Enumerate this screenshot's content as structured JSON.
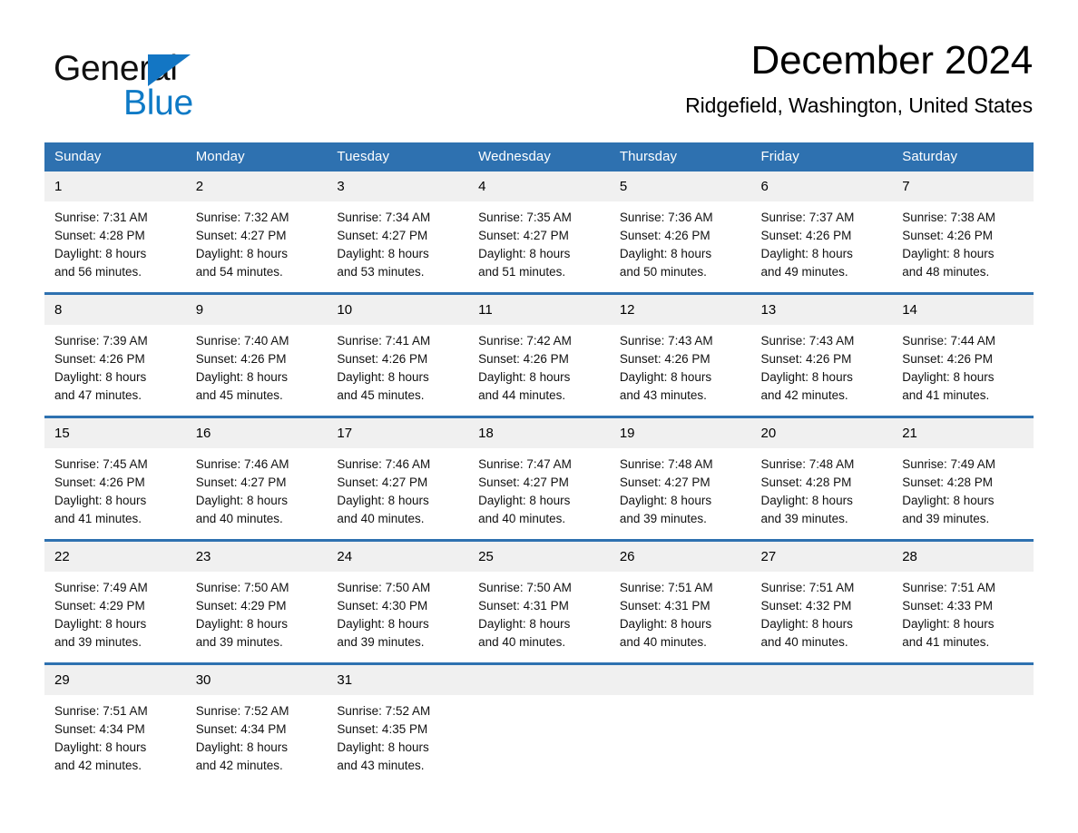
{
  "brand": {
    "word_general": "General",
    "word_blue": "Blue",
    "triangle_color": "#1376c4",
    "blue_text_color": "#0e7ac6"
  },
  "header": {
    "title": "December 2024",
    "subtitle": "Ridgefield, Washington, United States",
    "accent_color": "#2e71b0",
    "daynum_band_color": "#f0f0f0"
  },
  "weekday_headers": [
    "Sunday",
    "Monday",
    "Tuesday",
    "Wednesday",
    "Thursday",
    "Friday",
    "Saturday"
  ],
  "weeks": [
    [
      {
        "day": "1",
        "sunrise": "Sunrise: 7:31 AM",
        "sunset": "Sunset: 4:28 PM",
        "daylight1": "Daylight: 8 hours",
        "daylight2": "and 56 minutes."
      },
      {
        "day": "2",
        "sunrise": "Sunrise: 7:32 AM",
        "sunset": "Sunset: 4:27 PM",
        "daylight1": "Daylight: 8 hours",
        "daylight2": "and 54 minutes."
      },
      {
        "day": "3",
        "sunrise": "Sunrise: 7:34 AM",
        "sunset": "Sunset: 4:27 PM",
        "daylight1": "Daylight: 8 hours",
        "daylight2": "and 53 minutes."
      },
      {
        "day": "4",
        "sunrise": "Sunrise: 7:35 AM",
        "sunset": "Sunset: 4:27 PM",
        "daylight1": "Daylight: 8 hours",
        "daylight2": "and 51 minutes."
      },
      {
        "day": "5",
        "sunrise": "Sunrise: 7:36 AM",
        "sunset": "Sunset: 4:26 PM",
        "daylight1": "Daylight: 8 hours",
        "daylight2": "and 50 minutes."
      },
      {
        "day": "6",
        "sunrise": "Sunrise: 7:37 AM",
        "sunset": "Sunset: 4:26 PM",
        "daylight1": "Daylight: 8 hours",
        "daylight2": "and 49 minutes."
      },
      {
        "day": "7",
        "sunrise": "Sunrise: 7:38 AM",
        "sunset": "Sunset: 4:26 PM",
        "daylight1": "Daylight: 8 hours",
        "daylight2": "and 48 minutes."
      }
    ],
    [
      {
        "day": "8",
        "sunrise": "Sunrise: 7:39 AM",
        "sunset": "Sunset: 4:26 PM",
        "daylight1": "Daylight: 8 hours",
        "daylight2": "and 47 minutes."
      },
      {
        "day": "9",
        "sunrise": "Sunrise: 7:40 AM",
        "sunset": "Sunset: 4:26 PM",
        "daylight1": "Daylight: 8 hours",
        "daylight2": "and 45 minutes."
      },
      {
        "day": "10",
        "sunrise": "Sunrise: 7:41 AM",
        "sunset": "Sunset: 4:26 PM",
        "daylight1": "Daylight: 8 hours",
        "daylight2": "and 45 minutes."
      },
      {
        "day": "11",
        "sunrise": "Sunrise: 7:42 AM",
        "sunset": "Sunset: 4:26 PM",
        "daylight1": "Daylight: 8 hours",
        "daylight2": "and 44 minutes."
      },
      {
        "day": "12",
        "sunrise": "Sunrise: 7:43 AM",
        "sunset": "Sunset: 4:26 PM",
        "daylight1": "Daylight: 8 hours",
        "daylight2": "and 43 minutes."
      },
      {
        "day": "13",
        "sunrise": "Sunrise: 7:43 AM",
        "sunset": "Sunset: 4:26 PM",
        "daylight1": "Daylight: 8 hours",
        "daylight2": "and 42 minutes."
      },
      {
        "day": "14",
        "sunrise": "Sunrise: 7:44 AM",
        "sunset": "Sunset: 4:26 PM",
        "daylight1": "Daylight: 8 hours",
        "daylight2": "and 41 minutes."
      }
    ],
    [
      {
        "day": "15",
        "sunrise": "Sunrise: 7:45 AM",
        "sunset": "Sunset: 4:26 PM",
        "daylight1": "Daylight: 8 hours",
        "daylight2": "and 41 minutes."
      },
      {
        "day": "16",
        "sunrise": "Sunrise: 7:46 AM",
        "sunset": "Sunset: 4:27 PM",
        "daylight1": "Daylight: 8 hours",
        "daylight2": "and 40 minutes."
      },
      {
        "day": "17",
        "sunrise": "Sunrise: 7:46 AM",
        "sunset": "Sunset: 4:27 PM",
        "daylight1": "Daylight: 8 hours",
        "daylight2": "and 40 minutes."
      },
      {
        "day": "18",
        "sunrise": "Sunrise: 7:47 AM",
        "sunset": "Sunset: 4:27 PM",
        "daylight1": "Daylight: 8 hours",
        "daylight2": "and 40 minutes."
      },
      {
        "day": "19",
        "sunrise": "Sunrise: 7:48 AM",
        "sunset": "Sunset: 4:27 PM",
        "daylight1": "Daylight: 8 hours",
        "daylight2": "and 39 minutes."
      },
      {
        "day": "20",
        "sunrise": "Sunrise: 7:48 AM",
        "sunset": "Sunset: 4:28 PM",
        "daylight1": "Daylight: 8 hours",
        "daylight2": "and 39 minutes."
      },
      {
        "day": "21",
        "sunrise": "Sunrise: 7:49 AM",
        "sunset": "Sunset: 4:28 PM",
        "daylight1": "Daylight: 8 hours",
        "daylight2": "and 39 minutes."
      }
    ],
    [
      {
        "day": "22",
        "sunrise": "Sunrise: 7:49 AM",
        "sunset": "Sunset: 4:29 PM",
        "daylight1": "Daylight: 8 hours",
        "daylight2": "and 39 minutes."
      },
      {
        "day": "23",
        "sunrise": "Sunrise: 7:50 AM",
        "sunset": "Sunset: 4:29 PM",
        "daylight1": "Daylight: 8 hours",
        "daylight2": "and 39 minutes."
      },
      {
        "day": "24",
        "sunrise": "Sunrise: 7:50 AM",
        "sunset": "Sunset: 4:30 PM",
        "daylight1": "Daylight: 8 hours",
        "daylight2": "and 39 minutes."
      },
      {
        "day": "25",
        "sunrise": "Sunrise: 7:50 AM",
        "sunset": "Sunset: 4:31 PM",
        "daylight1": "Daylight: 8 hours",
        "daylight2": "and 40 minutes."
      },
      {
        "day": "26",
        "sunrise": "Sunrise: 7:51 AM",
        "sunset": "Sunset: 4:31 PM",
        "daylight1": "Daylight: 8 hours",
        "daylight2": "and 40 minutes."
      },
      {
        "day": "27",
        "sunrise": "Sunrise: 7:51 AM",
        "sunset": "Sunset: 4:32 PM",
        "daylight1": "Daylight: 8 hours",
        "daylight2": "and 40 minutes."
      },
      {
        "day": "28",
        "sunrise": "Sunrise: 7:51 AM",
        "sunset": "Sunset: 4:33 PM",
        "daylight1": "Daylight: 8 hours",
        "daylight2": "and 41 minutes."
      }
    ],
    [
      {
        "day": "29",
        "sunrise": "Sunrise: 7:51 AM",
        "sunset": "Sunset: 4:34 PM",
        "daylight1": "Daylight: 8 hours",
        "daylight2": "and 42 minutes."
      },
      {
        "day": "30",
        "sunrise": "Sunrise: 7:52 AM",
        "sunset": "Sunset: 4:34 PM",
        "daylight1": "Daylight: 8 hours",
        "daylight2": "and 42 minutes."
      },
      {
        "day": "31",
        "sunrise": "Sunrise: 7:52 AM",
        "sunset": "Sunset: 4:35 PM",
        "daylight1": "Daylight: 8 hours",
        "daylight2": "and 43 minutes."
      },
      {
        "day": "",
        "sunrise": "",
        "sunset": "",
        "daylight1": "",
        "daylight2": ""
      },
      {
        "day": "",
        "sunrise": "",
        "sunset": "",
        "daylight1": "",
        "daylight2": ""
      },
      {
        "day": "",
        "sunrise": "",
        "sunset": "",
        "daylight1": "",
        "daylight2": ""
      },
      {
        "day": "",
        "sunrise": "",
        "sunset": "",
        "daylight1": "",
        "daylight2": ""
      }
    ]
  ]
}
